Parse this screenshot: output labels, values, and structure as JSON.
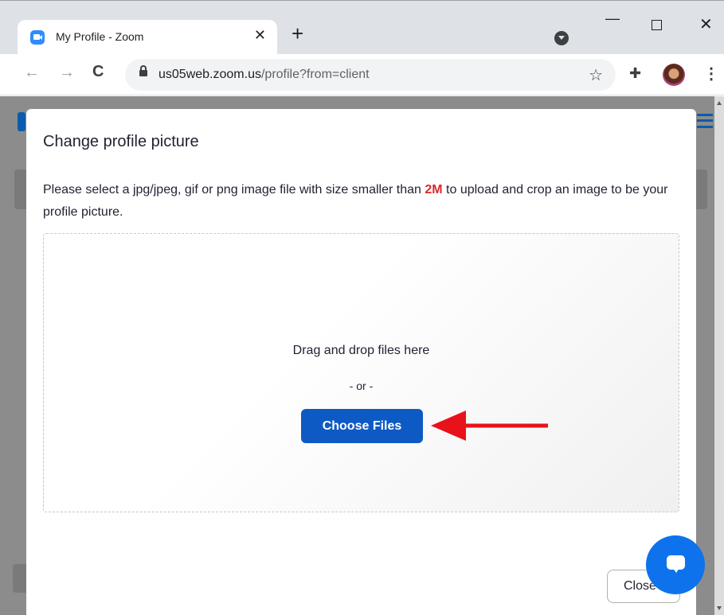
{
  "browser": {
    "tab_title": "My Profile - Zoom",
    "tab_close": "✕",
    "new_tab": "+",
    "url_host": "us05web.zoom.us",
    "url_path": "/profile?from=client",
    "window_min": "—",
    "window_close": "✕"
  },
  "modal": {
    "title": "Change profile picture",
    "desc_before": "Please select a jpg/jpeg, gif or png image file with size smaller than ",
    "desc_limit": "2M",
    "desc_after": " to upload and crop an image to be your profile picture.",
    "drop_text": "Drag and drop files here",
    "or_text": "- or -",
    "choose_button": "Choose Files",
    "close_button": "Close"
  },
  "colors": {
    "primary": "#0e5ac4",
    "accent_red": "#e02828",
    "chat": "#0e72ed"
  }
}
